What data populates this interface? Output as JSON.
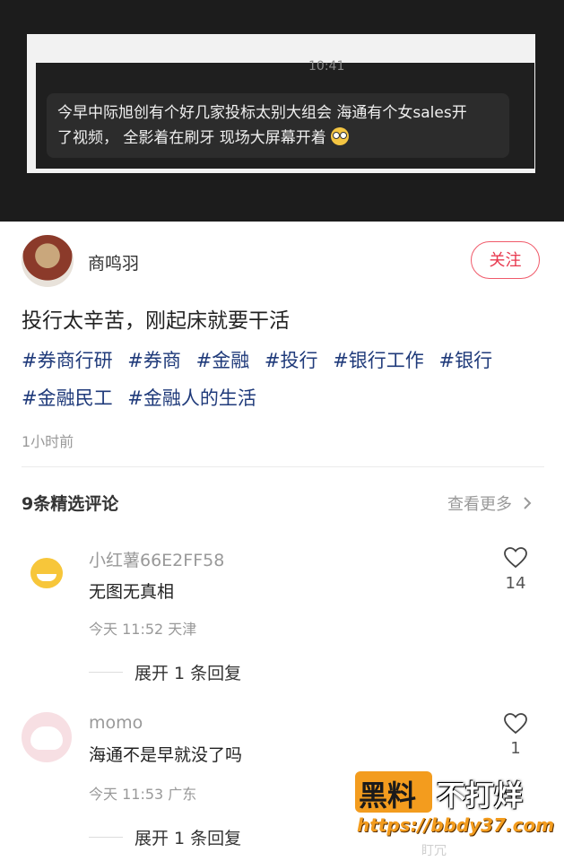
{
  "screenshot": {
    "time": "10:41",
    "message_line1": "今早中际旭创有个好几家投标太别大组会 海通有个女sales开",
    "message_line2": "了视频， 全影着在刷牙 现场大屏幕开着",
    "emoji": "flushed-face"
  },
  "author": {
    "name": "商鸣羽",
    "follow_label": "关注"
  },
  "post": {
    "title": "投行太辛苦，刚起床就要干活",
    "tags": [
      "#券商行研",
      "#券商",
      "#金融",
      "#投行",
      "#银行工作",
      "#银行",
      "#金融民工",
      "#金融人的生活"
    ],
    "time": "1小时前"
  },
  "comments_section": {
    "header": "9条精选评论",
    "see_more": "查看更多",
    "see_more_icon": "chevron-right"
  },
  "comments": [
    {
      "name": "小红薯66E2FF58",
      "text": "无图无真相",
      "meta": "今天 11:52 天津",
      "likes": "14",
      "reply_label": "展开 1 条回复"
    },
    {
      "name": "momo",
      "text": "海通不是早就没了吗",
      "meta": "今天 11:53 广东",
      "likes": "1",
      "reply_label": "展开 1 条回复"
    }
  ],
  "watermark": {
    "badge": "黑料",
    "brand": "不打烊",
    "url": "https://bbdy37.com",
    "small": "盯冗"
  },
  "colors": {
    "accent": "#e8384e",
    "tag_blue": "#1f3a7a",
    "watermark_orange": "#f39c1e"
  }
}
